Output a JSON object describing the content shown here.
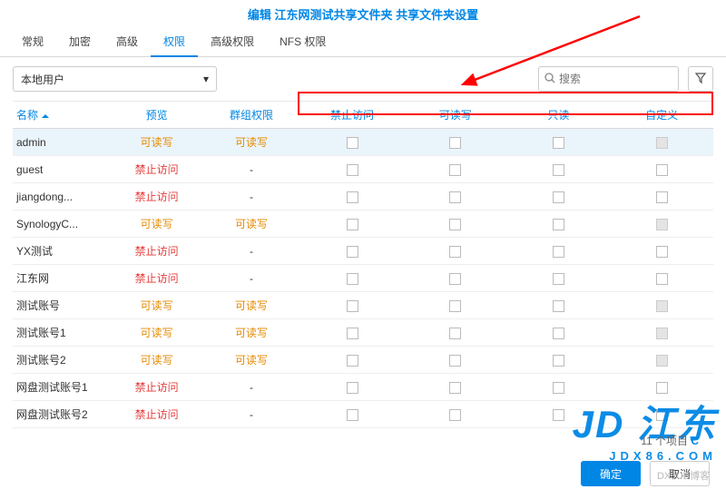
{
  "header": {
    "title": "编辑 江东网测试共享文件夹 共享文件夹设置"
  },
  "tabs": [
    {
      "label": "常规",
      "active": false
    },
    {
      "label": "加密",
      "active": false
    },
    {
      "label": "高级",
      "active": false
    },
    {
      "label": "权限",
      "active": true
    },
    {
      "label": "高级权限",
      "active": false
    },
    {
      "label": "NFS 权限",
      "active": false
    }
  ],
  "toolbar": {
    "user_scope": "本地用户",
    "search_placeholder": "搜索"
  },
  "columns": {
    "name": "名称",
    "preview": "预览",
    "group": "群组权限",
    "deny": "禁止访问",
    "rw": "可读写",
    "ro": "只读",
    "custom": "自定义"
  },
  "rows": [
    {
      "name": "admin",
      "preview": "可读写",
      "preview_cls": "status-write",
      "group": "可读写",
      "group_cls": "status-write",
      "sel": true,
      "custom_dis": true
    },
    {
      "name": "guest",
      "preview": "禁止访问",
      "preview_cls": "status-deny",
      "group": "-",
      "custom_dis": false
    },
    {
      "name": "jiangdong...",
      "preview": "禁止访问",
      "preview_cls": "status-deny",
      "group": "-",
      "custom_dis": false
    },
    {
      "name": "SynologyC...",
      "preview": "可读写",
      "preview_cls": "status-write",
      "group": "可读写",
      "group_cls": "status-write",
      "custom_dis": true
    },
    {
      "name": "YX测试",
      "preview": "禁止访问",
      "preview_cls": "status-deny",
      "group": "-",
      "custom_dis": false
    },
    {
      "name": "江东网",
      "preview": "禁止访问",
      "preview_cls": "status-deny",
      "group": "-",
      "custom_dis": false
    },
    {
      "name": "测试账号",
      "preview": "可读写",
      "preview_cls": "status-write",
      "group": "可读写",
      "group_cls": "status-write",
      "custom_dis": true
    },
    {
      "name": "测试账号1",
      "preview": "可读写",
      "preview_cls": "status-write",
      "group": "可读写",
      "group_cls": "status-write",
      "custom_dis": true
    },
    {
      "name": "测试账号2",
      "preview": "可读写",
      "preview_cls": "status-write",
      "group": "可读写",
      "group_cls": "status-write",
      "custom_dis": true
    },
    {
      "name": "网盘测试账号1",
      "preview": "禁止访问",
      "preview_cls": "status-deny",
      "group": "-",
      "custom_dis": false
    },
    {
      "name": "网盘测试账号2",
      "preview": "禁止访问",
      "preview_cls": "status-deny",
      "group": "-",
      "custom_dis": false
    }
  ],
  "footer": {
    "count_label": "11 个项目",
    "ok": "确定",
    "cancel": "取消"
  },
  "watermark": {
    "big": "JD 江东",
    "small": "JDX86.COM",
    "blog": "DXJUB博客",
    "c": "C"
  }
}
